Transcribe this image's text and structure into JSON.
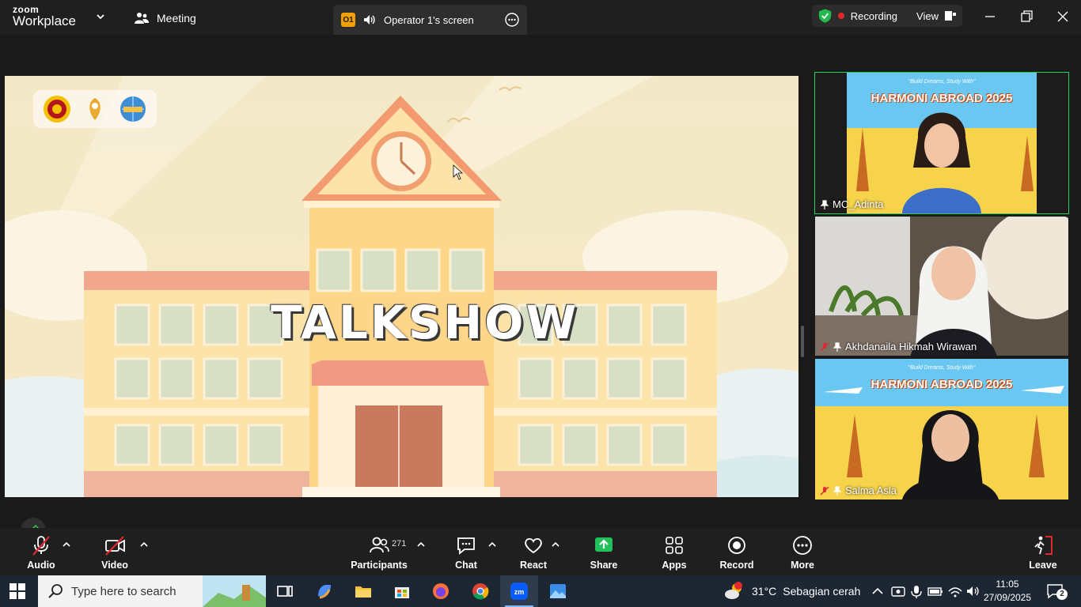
{
  "topbar": {
    "logo_line1": "zoom",
    "logo_line2": "Workplace",
    "meeting_label": "Meeting",
    "share_badge": "O1",
    "share_title": "Operator 1's screen",
    "recording_label": "Recording",
    "view_label": "View"
  },
  "share": {
    "headline": "TALKSHOW"
  },
  "tiles": [
    {
      "name": "MC_Adinta",
      "active": true,
      "muted": false
    },
    {
      "name": "Akhdanaila Hikmah Wirawan",
      "active": false,
      "muted": true
    },
    {
      "name": "Salma Asla",
      "active": false,
      "muted": true
    }
  ],
  "backdrop": {
    "tagline": "\"Build Dreams, Study With\"",
    "title": "HARMONI ABROAD 2025"
  },
  "toolbar": {
    "audio": "Audio",
    "video": "Video",
    "participants": "Participants",
    "participants_count": "271",
    "chat": "Chat",
    "react": "React",
    "share": "Share",
    "apps": "Apps",
    "record": "Record",
    "more": "More",
    "leave": "Leave"
  },
  "taskbar": {
    "search_placeholder": "Type here to search",
    "weather_temp": "31°C",
    "weather_desc": "Sebagian cerah",
    "time": "11:05",
    "date": "27/09/2025",
    "notification_count": "2"
  },
  "colors": {
    "accent_green": "#1fd35c",
    "recording_red": "#e02828",
    "share_green": "#21c05a",
    "leave_red": "#e0282f"
  }
}
